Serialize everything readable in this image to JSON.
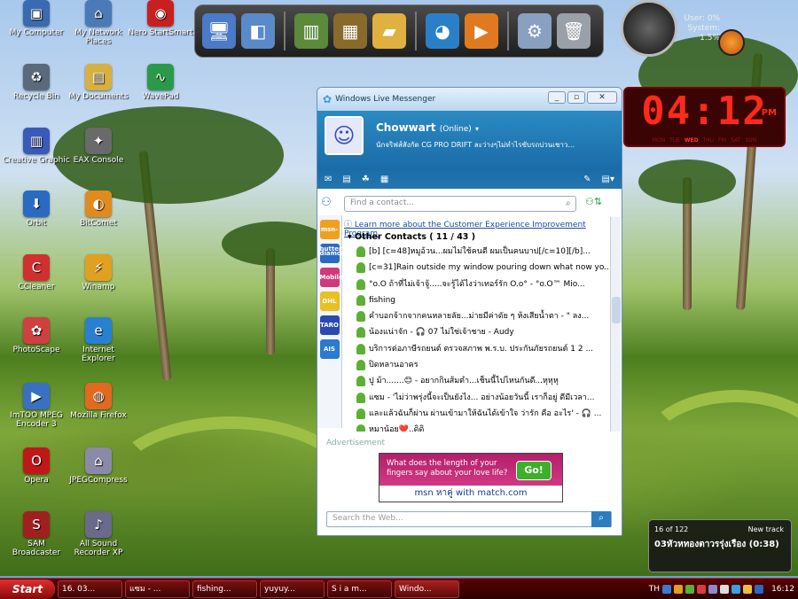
{
  "desktop_icons": [
    {
      "label": "My Computer",
      "icon": "computer-icon",
      "color": "#3a6ab0",
      "glyph": "▣"
    },
    {
      "label": "My Network Places",
      "icon": "network-icon",
      "color": "#4a7ab8",
      "glyph": "⌂"
    },
    {
      "label": "Nero StartSmart",
      "icon": "nero-icon",
      "color": "#c82020",
      "glyph": "◉"
    },
    {
      "label": "Recycle Bin",
      "icon": "recycle-bin-icon",
      "color": "#5a6a7a",
      "glyph": "♻"
    },
    {
      "label": "My Documents",
      "icon": "documents-icon",
      "color": "#d8b040",
      "glyph": "▤"
    },
    {
      "label": "WavePad",
      "icon": "wavepad-icon",
      "color": "#2a9a4a",
      "glyph": "∿"
    },
    {
      "label": "Creative Graphic",
      "icon": "creative-icon",
      "color": "#3a5ab8",
      "glyph": "▥"
    },
    {
      "label": "EAX Console",
      "icon": "eax-icon",
      "color": "#6a6a6a",
      "glyph": "✦"
    },
    {
      "label": "Orbit",
      "icon": "orbit-icon",
      "color": "#2a6ac0",
      "glyph": "⬇"
    },
    {
      "label": "BitComet",
      "icon": "bitcomet-icon",
      "color": "#e08a20",
      "glyph": "◐"
    },
    {
      "label": "CCleaner",
      "icon": "ccleaner-icon",
      "color": "#d03030",
      "glyph": "C"
    },
    {
      "label": "Winamp",
      "icon": "winamp-icon",
      "color": "#e0a020",
      "glyph": "⚡"
    },
    {
      "label": "PhotoScape",
      "icon": "photoscape-icon",
      "color": "#d04040",
      "glyph": "✿"
    },
    {
      "label": "Internet Explorer",
      "icon": "ie-icon",
      "color": "#2a80d0",
      "glyph": "e"
    },
    {
      "label": "ImTOO MPEG Encoder 3",
      "icon": "imtoo-icon",
      "color": "#3a70c0",
      "glyph": "▶"
    },
    {
      "label": "Mozilla Firefox",
      "icon": "firefox-icon",
      "color": "#e06a20",
      "glyph": "◍"
    },
    {
      "label": "Opera",
      "icon": "opera-icon",
      "color": "#c01818",
      "glyph": "O"
    },
    {
      "label": "JPEGCompress",
      "icon": "jpegcompress-icon",
      "color": "#8a8aa8",
      "glyph": "⌂"
    },
    {
      "label": "SAM Broadcaster",
      "icon": "sam-icon",
      "color": "#a02020",
      "glyph": "S"
    },
    {
      "label": "All Sound Recorder XP",
      "icon": "sound-recorder-icon",
      "color": "#6a6a8a",
      "glyph": "♪"
    }
  ],
  "dock_icons": [
    {
      "icon": "monitor-icon",
      "glyph": "🖥"
    },
    {
      "icon": "drive-icon",
      "glyph": "◧"
    },
    {
      "icon": "books-icon",
      "glyph": "▥"
    },
    {
      "icon": "book-icon",
      "glyph": "▦"
    },
    {
      "icon": "folder-icon",
      "glyph": "▰"
    },
    {
      "icon": "globe-icon",
      "glyph": "◕"
    },
    {
      "icon": "media-player-icon",
      "glyph": "▶"
    },
    {
      "icon": "settings-gear-icon",
      "glyph": "⚙"
    },
    {
      "icon": "trash-icon",
      "glyph": "🗑"
    }
  ],
  "system_monitor": {
    "user": "User: 0%",
    "system": "System: 1.5%"
  },
  "digital_clock": {
    "time": "04:12",
    "ampm": "PM",
    "days": [
      "MON",
      "TUE",
      "WED",
      "THU",
      "FRI",
      "SAT",
      "SUN"
    ],
    "active_day": "WED"
  },
  "messenger": {
    "title": "Windows Live Messenger",
    "user_name": "Chowwart",
    "user_status": "(Online)",
    "personal_message": "นักจริฟส์สังกัด CG PRO DRIFT ละว่างๆไม่ทำไรขับรถบ่วนเชาว...",
    "search_placeholder": "Find a contact...",
    "notice": "Learn more about the Customer Experience Improvement Program.",
    "group": "Other Contacts ( 11 / 43 )",
    "contacts": [
      "[b]  [c=48]หมูอ้วน...ผมไม่ใช้คนดี ผมเป็นคนบาป[/c=10][/b]...",
      "[c=31]Rain outside my window pouring down what now yo...",
      "°o.O ถ้าที่ไม่เจ้าจู้.....จะรู้ได้ไงว่าเทอร์รัก O.o° - °o.O™  Mio...",
      "fishing",
      "คำบอกจ้ากจากคนหลายลัย...ม่ายมีค่าดัย ๆ ห้งเสียน้ำตา - \" ลง...",
      "น้องแน่าจัก - 🎧 07 ไม่ใช่เจ้าชาย - Audy",
      "บริการต่อภาษีรถยนต์ ตรวจสภาพ พ.ร.บ. ประกันภัยรถยนต์ 1 2 ...",
      "ปิดหลานอาคร",
      "ปู ม้า.......😊 - อยากกินส้มตำ...เช็นนี้ไปไหนกันดี...หุหุหุ",
      "แซม - 'ไม่ว่าพรุ่งนี้จะเป็นยังไง... อย่างน้อยวันนี้ เราก็อยู่ ดีมีเวลา...",
      "และแล้วฉันก็ผ่าน ผ่านเข้ามาให้ฉันได้เข้าใจ ว่ารัก คือ อะไร' - 🎧 ...",
      "หมาน้อย❤️..ดิดิ"
    ],
    "sidebar": [
      "msn-butterfly",
      "diamond",
      "Mobile",
      "DHL",
      "TARO",
      "AIS"
    ],
    "advertisement_label": "Advertisement",
    "ad_text": "What does the length of your fingers say about your love life?",
    "ad_button": "Go!",
    "ad_brand": "msn หาคู่ with match.com",
    "web_search_placeholder": "Search the Web..."
  },
  "now_playing": {
    "position": "16 of 122",
    "label": "New track",
    "title": "03หัวหทองตาวรรุ่งเรือง (0:38)"
  },
  "taskbar": {
    "start": "Start",
    "buttons": [
      "16. 03...",
      "แซม - ...",
      "fishing...",
      "yuyuy...",
      "S i a m...",
      "Windo..."
    ],
    "active_index": 5,
    "lang": "TH",
    "time": "16:12"
  }
}
